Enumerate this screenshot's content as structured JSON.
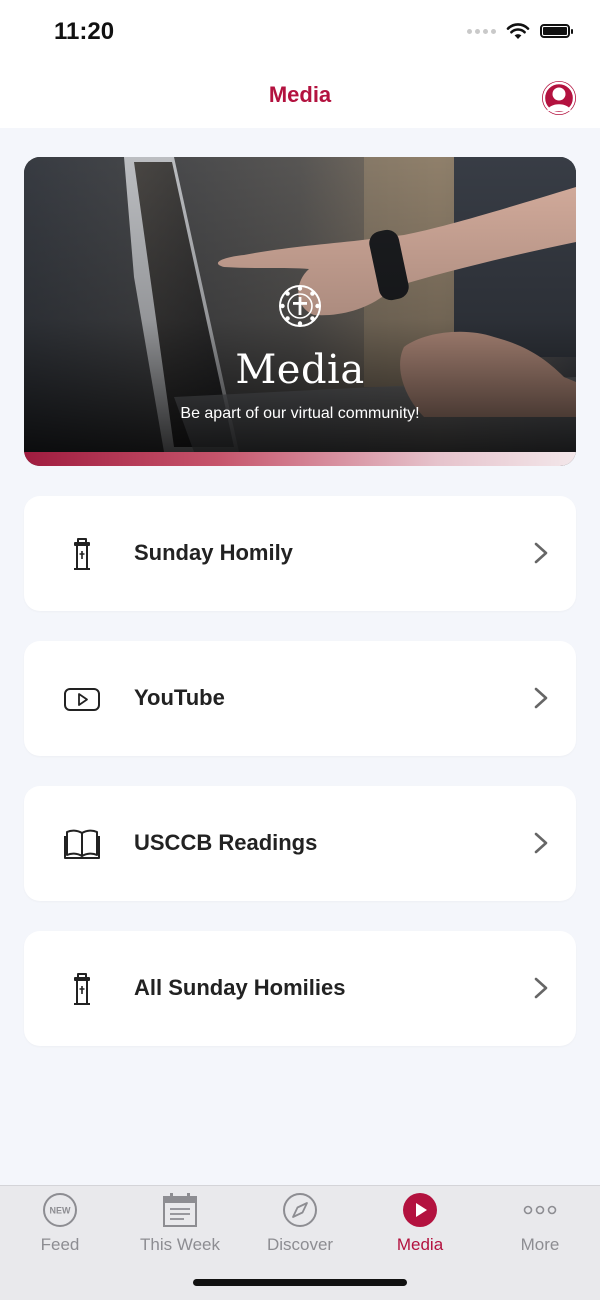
{
  "status_bar": {
    "time": "11:20"
  },
  "navbar": {
    "title": "Media"
  },
  "hero": {
    "title": "Media",
    "subtitle": "Be apart of our virtual community!",
    "accent_color": "#b3123f"
  },
  "menu": {
    "items": [
      {
        "label": "Sunday Homily",
        "icon": "pulpit-icon"
      },
      {
        "label": "YouTube",
        "icon": "youtube-play-icon"
      },
      {
        "label": "USCCB Readings",
        "icon": "open-book-icon"
      },
      {
        "label": "All Sunday Homilies",
        "icon": "pulpit-icon"
      }
    ]
  },
  "tabbar": {
    "active": "Media",
    "tabs": [
      {
        "label": "Feed",
        "icon": "new-badge-icon",
        "badge_text": "NEW"
      },
      {
        "label": "This Week",
        "icon": "calendar-icon"
      },
      {
        "label": "Discover",
        "icon": "compass-icon"
      },
      {
        "label": "Media",
        "icon": "play-circle-icon"
      },
      {
        "label": "More",
        "icon": "more-dots-icon"
      }
    ]
  },
  "colors": {
    "accent": "#b3123f",
    "background": "#f4f6fb",
    "tab_inactive": "#8d8d92"
  }
}
